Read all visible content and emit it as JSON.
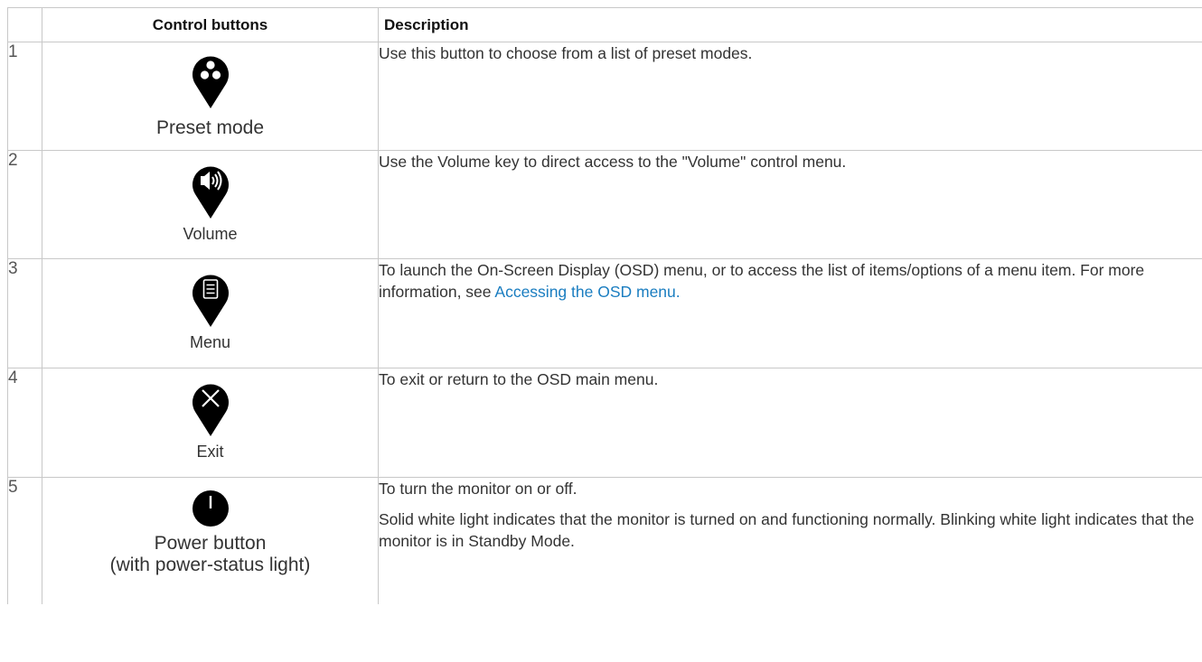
{
  "header": {
    "num": "",
    "control_buttons": "Control buttons",
    "description": "Description"
  },
  "rows": [
    {
      "num": "1",
      "icon": "preset-mode-icon",
      "label": "Preset mode",
      "desc": [
        "Use this button to choose from a list of preset modes."
      ]
    },
    {
      "num": "2",
      "icon": "volume-icon",
      "label": "Volume",
      "desc": [
        "Use the Volume key to direct access to the \"Volume\" control menu."
      ]
    },
    {
      "num": "3",
      "icon": "menu-icon",
      "label": "Menu",
      "desc_text": "To launch the On-Screen Display (OSD) menu, or to access the list of items/options of a menu item. For more information, see ",
      "desc_link": "Accessing the OSD menu."
    },
    {
      "num": "4",
      "icon": "exit-icon",
      "label": "Exit",
      "desc": [
        "To exit or return to the OSD main menu."
      ]
    },
    {
      "num": "5",
      "icon": "power-icon",
      "label_line1": "Power button",
      "label_line2": "(with power-status light)",
      "desc": [
        "To turn the monitor on or off.",
        "Solid white light indicates that the monitor is turned on and functioning normally. Blinking white light indicates that the monitor is in Standby Mode."
      ]
    }
  ],
  "colors": {
    "link": "#1a7dc0",
    "icon": "#000000",
    "border": "#c8c8c8"
  }
}
